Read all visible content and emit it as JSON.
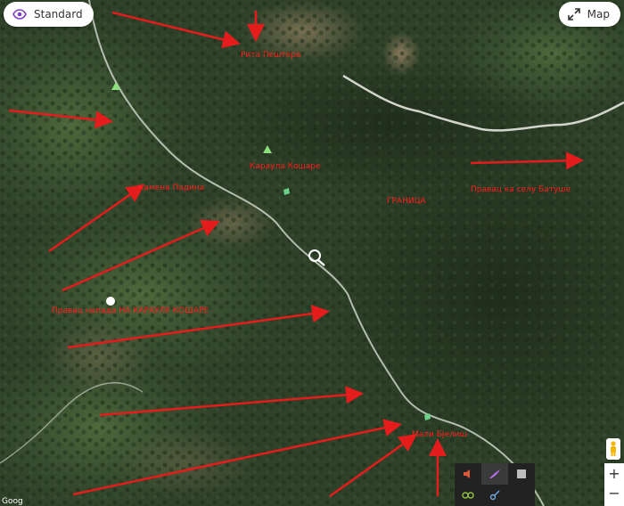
{
  "view_toggle": {
    "label": "Standard",
    "icon": "eye-icon"
  },
  "map_toggle": {
    "label": "Map",
    "icon": "expand-arrows-icon"
  },
  "labels": {
    "rock_peak": "Рита Пештера",
    "karaula_koshare": "Караула Кошаре",
    "kamena_padina": "Камена Падина",
    "border_line": "ГРАНИЦА",
    "ridge_east": "Правац ка селу Батуше",
    "village_trail": "Правац напада НА КАРАУЛУ КОШАРЕ",
    "mali_bjelis": "Мали Бјелиш"
  },
  "zoom": {
    "in": "+",
    "out": "−"
  },
  "attribution": "Goog",
  "colors": {
    "arrow": "#e51c1c",
    "label": "#ff1d1d",
    "accent": "#7a3fbf"
  }
}
